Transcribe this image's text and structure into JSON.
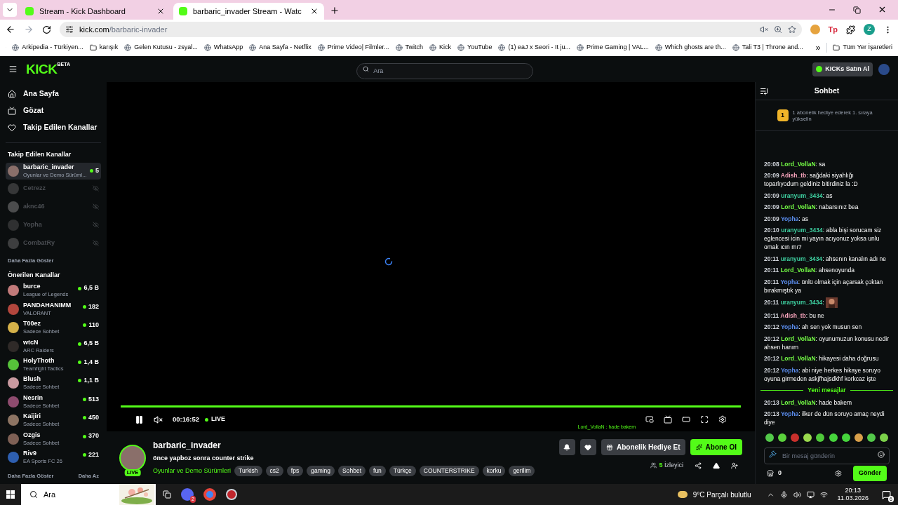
{
  "browser": {
    "tabs": [
      {
        "title": "Stream - Kick Dashboard",
        "selected": false
      },
      {
        "title": "barbaric_invader Stream - Watc",
        "selected": true
      }
    ],
    "url_host": "kick.com",
    "url_path": "/barbaric-invader",
    "bookmarks": [
      {
        "kind": "site",
        "label": "Arkipedia - Türkiyen..."
      },
      {
        "kind": "folder",
        "label": "karışık"
      },
      {
        "kind": "site",
        "label": "Gelen Kutusu - zsyal..."
      },
      {
        "kind": "site",
        "label": "WhatsApp"
      },
      {
        "kind": "site",
        "label": "Ana Sayfa - Netflix"
      },
      {
        "kind": "site",
        "label": "Prime Video| Filmler..."
      },
      {
        "kind": "site",
        "label": "Twitch"
      },
      {
        "kind": "site",
        "label": "Kick"
      },
      {
        "kind": "site",
        "label": "YouTube"
      },
      {
        "kind": "site",
        "label": "(1) eaJ x Seori - It ju..."
      },
      {
        "kind": "site",
        "label": "Prime Gaming | VAL..."
      },
      {
        "kind": "site",
        "label": "Which ghosts are th..."
      },
      {
        "kind": "site",
        "label": "Tali T3 | Throne and..."
      }
    ],
    "overflow": "»",
    "all_bookmarks": "Tüm Yer İşaretleri",
    "profile_initial": "Z",
    "extension_label": "Tp"
  },
  "header": {
    "logo": "KICK",
    "logo_badge": "BETA",
    "search_placeholder": "Ara",
    "buy_button": "KICKs Satın Al"
  },
  "sidebar": {
    "nav": [
      {
        "kind": "home",
        "label": "Ana Sayfa"
      },
      {
        "kind": "browse",
        "label": "Gözat"
      },
      {
        "kind": "following",
        "label": "Takip Edilen Kanallar"
      }
    ],
    "followed_title": "Takip Edilen Kanallar",
    "followed": [
      {
        "name": "barbaric_invader",
        "category": "Oyunlar ve Demo Sürüml...",
        "viewers": "5",
        "live": true,
        "selected": true
      },
      {
        "name": "Cetrezz",
        "live": false,
        "selected": false
      },
      {
        "name": "aknc46",
        "live": false,
        "selected": false
      },
      {
        "name": "Yopha",
        "live": false,
        "selected": false
      },
      {
        "name": "CombatRy",
        "live": false,
        "selected": false
      }
    ],
    "followed_more": "Daha Fazla Göster",
    "recommended_title": "Önerilen Kanallar",
    "recommended": [
      {
        "name": "burce",
        "category": "League of Legends",
        "viewers": "6,5 B"
      },
      {
        "name": "PANDAHANIMM",
        "category": "VALORANT",
        "viewers": "182"
      },
      {
        "name": "T00ez",
        "category": "Sadece Sohbet",
        "viewers": "110"
      },
      {
        "name": "wtcN",
        "category": "ARC Raiders",
        "viewers": "6,5 B"
      },
      {
        "name": "HolyThoth",
        "category": "Teamfight Tactics",
        "viewers": "1,4 B"
      },
      {
        "name": "Blush",
        "category": "Sadece Sohbet",
        "viewers": "1,1 B"
      },
      {
        "name": "Nesrin",
        "category": "Sadece Sohbet",
        "viewers": "513"
      },
      {
        "name": "Kaijiri",
        "category": "Sadece Sohbet",
        "viewers": "450"
      },
      {
        "name": "Ozgis",
        "category": "Sadece Sohbet",
        "viewers": "370"
      },
      {
        "name": "Riv9",
        "category": "EA Sports FC 26",
        "viewers": "221"
      }
    ],
    "recommended_more": "Daha Fazla Göster",
    "recommended_less": "Daha Az"
  },
  "player": {
    "loading": true,
    "seek": {
      "level": 1
    },
    "time": "00:16:52",
    "live_label": "LIVE",
    "paused": false,
    "muted": true,
    "overlay_chat": "Lord_VollaN : hade bakem"
  },
  "stream": {
    "channel": "barbaric_invader",
    "live_badge": "LIVE",
    "title": "önce yapboz sonra counter strike",
    "category": "Oyunlar ve Demo Sürümleri",
    "tags": [
      "Turkish",
      "cs2",
      "fps",
      "gaming",
      "Sohbet",
      "fun",
      "Türkçe",
      "COUNTERSTRIKE",
      "korku",
      "gerilim"
    ],
    "gift_button": "Abonelik Hediye Et",
    "subscribe_button": "Abone Ol",
    "viewers": "5",
    "viewers_label": "İzleyici"
  },
  "chat": {
    "title": "Sohbet",
    "pinned": {
      "rank": "1",
      "text": "1 abonelik hediye ederek 1. sıraya yükselin"
    },
    "messages": [
      {
        "kind": "text",
        "time": "20:08",
        "user": "Lord_VollaN",
        "color": "#75fd46",
        "text": "sa"
      },
      {
        "kind": "text",
        "time": "20:09",
        "user": "Adish_tb",
        "color": "#f2a0b8",
        "text": "sağdaki siyahlığı toparlıyodum geldiniz bitirdiniz la :D"
      },
      {
        "kind": "text",
        "time": "20:09",
        "user": "uranyum_3434",
        "color": "#3ecfa0",
        "text": "as"
      },
      {
        "kind": "text",
        "time": "20:09",
        "user": "Lord_VollaN",
        "color": "#75fd46",
        "text": "nabarsınız bea"
      },
      {
        "kind": "text",
        "time": "20:09",
        "user": "Yopha",
        "color": "#5b8dee",
        "text": "as"
      },
      {
        "kind": "text",
        "time": "20:10",
        "user": "uranyum_3434",
        "color": "#3ecfa0",
        "text": "abla bişi sorucam siz eglencesi icin mi yayın acıyonuz yoksa unlu omak ıcın mı?"
      },
      {
        "kind": "text",
        "time": "20:11",
        "user": "uranyum_3434",
        "color": "#3ecfa0",
        "text": "ahsenın kanalın adı ne"
      },
      {
        "kind": "text",
        "time": "20:11",
        "user": "Lord_VollaN",
        "color": "#75fd46",
        "text": "ahsenoyunda"
      },
      {
        "kind": "text",
        "time": "20:11",
        "user": "Yopha",
        "color": "#5b8dee",
        "text": "ünlü olmak için açarsak çoktan bırakmıştık ya"
      },
      {
        "kind": "emote",
        "time": "20:11",
        "user": "uranyum_3434",
        "color": "#3ecfa0"
      },
      {
        "kind": "text",
        "time": "20:11",
        "user": "Adish_tb",
        "color": "#f2a0b8",
        "text": "bu ne"
      },
      {
        "kind": "text",
        "time": "20:12",
        "user": "Yopha",
        "color": "#5b8dee",
        "text": "ah sen yok musun sen"
      },
      {
        "kind": "text",
        "time": "20:12",
        "user": "Lord_VollaN",
        "color": "#75fd46",
        "text": "oyunumuzun konusu nedir ahsen hanım"
      },
      {
        "kind": "text",
        "time": "20:12",
        "user": "Lord_VollaN",
        "color": "#75fd46",
        "text": "hikayesi daha doğrusu"
      },
      {
        "kind": "text",
        "time": "20:12",
        "user": "Yopha",
        "color": "#5b8dee",
        "text": "abi niye herkes hikaye soruyo oyuna girmeden askjfhajsdkhf korkcaz işte"
      },
      {
        "kind": "divider",
        "text": "Yeni mesajlar"
      },
      {
        "kind": "text",
        "time": "20:13",
        "user": "Lord_VollaN",
        "color": "#75fd46",
        "text": "hade bakem"
      },
      {
        "kind": "text",
        "time": "20:13",
        "user": "Yopha",
        "color": "#5b8dee",
        "text": "ilker de dün soruyo amaç neydi diye"
      }
    ],
    "name_separator": ":",
    "input_placeholder": "Bir mesaj gönderin",
    "kicks": "0",
    "send_button": "Gönder"
  },
  "taskbar": {
    "search_placeholder": "Ara",
    "chat_badge": "2",
    "weather": "9°C Parçalı bulutlu",
    "time": "20:13",
    "date": "11.03.2026",
    "notifications": "6"
  }
}
